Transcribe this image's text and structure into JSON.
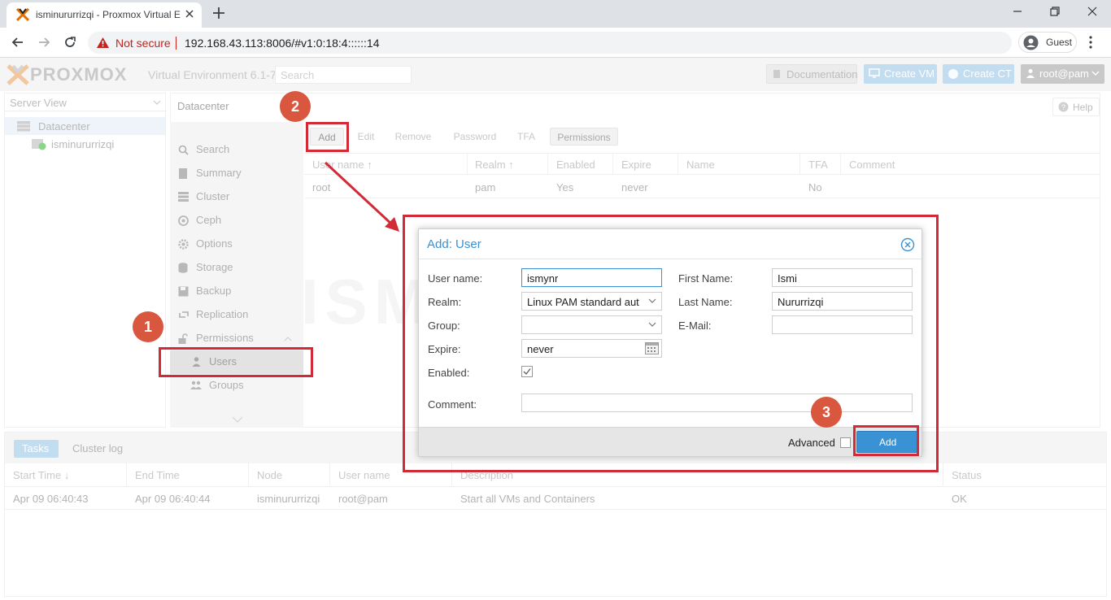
{
  "browser": {
    "tab_title": "isminururrizqi - Proxmox Virtual E",
    "security_label": "Not secure",
    "url": "192.168.43.113:8006/#v1:0:18:4::::::14",
    "profile_label": "Guest"
  },
  "header": {
    "logo_text": "PROXMOX",
    "product": "Virtual Environment 6.1-7",
    "search_placeholder": "Search",
    "documentation": "Documentation",
    "create_vm": "Create VM",
    "create_ct": "Create CT",
    "user": "root@pam"
  },
  "tree": {
    "view": "Server View",
    "items": [
      {
        "label": "Datacenter"
      },
      {
        "label": "isminururrizqi"
      }
    ]
  },
  "content": {
    "title": "Datacenter",
    "help": "Help"
  },
  "nav": {
    "items": [
      {
        "label": "Search"
      },
      {
        "label": "Summary"
      },
      {
        "label": "Cluster"
      },
      {
        "label": "Ceph"
      },
      {
        "label": "Options"
      },
      {
        "label": "Storage"
      },
      {
        "label": "Backup"
      },
      {
        "label": "Replication"
      },
      {
        "label": "Permissions"
      },
      {
        "label": "Users"
      },
      {
        "label": "Groups"
      }
    ]
  },
  "grid_toolbar": {
    "add": "Add",
    "edit": "Edit",
    "remove": "Remove",
    "password": "Password",
    "tfa": "TFA",
    "permissions": "Permissions"
  },
  "users_grid": {
    "columns": [
      "User name ↑",
      "Realm ↑",
      "Enabled",
      "Expire",
      "Name",
      "TFA",
      "Comment"
    ],
    "rows": [
      [
        "root",
        "pam",
        "Yes",
        "never",
        "",
        "No",
        ""
      ]
    ]
  },
  "dialog": {
    "title": "Add: User",
    "labels": {
      "username": "User name:",
      "realm": "Realm:",
      "group": "Group:",
      "expire": "Expire:",
      "enabled": "Enabled:",
      "comment": "Comment:",
      "firstname": "First Name:",
      "lastname": "Last Name:",
      "email": "E-Mail:"
    },
    "values": {
      "username": "ismynr",
      "realm": "Linux PAM standard aut",
      "group": "",
      "expire": "never",
      "enabled": true,
      "comment": "",
      "firstname": "Ismi",
      "lastname": "Nururrizqi",
      "email": ""
    },
    "advanced": "Advanced",
    "advanced_checked": false,
    "add_button": "Add"
  },
  "bottom": {
    "tabs": [
      "Tasks",
      "Cluster log"
    ],
    "columns": [
      "Start Time ↓",
      "End Time",
      "Node",
      "User name",
      "Description",
      "Status"
    ],
    "rows": [
      [
        "Apr 09 06:40:43",
        "Apr 09 06:40:44",
        "isminururrizqi",
        "root@pam",
        "Start all VMs and Containers",
        "OK"
      ]
    ]
  },
  "annotations": {
    "step1": "1",
    "step2": "2",
    "step3": "3",
    "color": "#d32a37"
  },
  "watermark": "ISMYNR.XYZ"
}
